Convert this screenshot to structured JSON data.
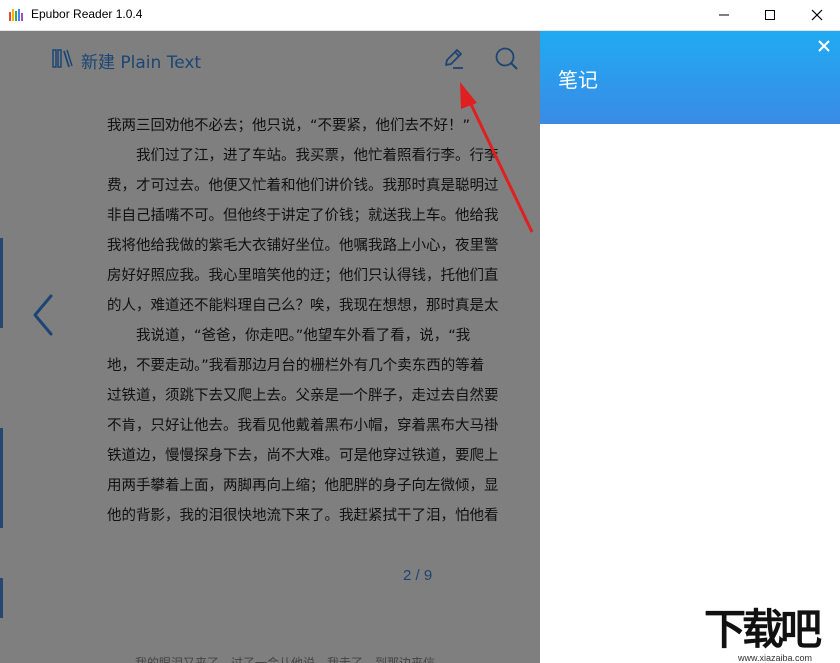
{
  "window": {
    "title": "Epubor Reader 1.0.4",
    "buttons": {
      "minimize": "minimize",
      "maximize": "maximize",
      "close": "close"
    }
  },
  "reader": {
    "book_title": "新建 Plain Text",
    "tools": [
      "pen-icon",
      "search-icon"
    ],
    "paragraph_lines": [
      "我两三回劝他不必去；他只说，“不要紧，他们去不好！”",
      "　　我们过了江，进了车站。我买票，他忙着照看行李。行李",
      "费，才可过去。他便又忙着和他们讲价钱。我那时真是聪明过",
      "非自己插嘴不可。但他终于讲定了价钱；就送我上车。他给我",
      "我将他给我做的紫毛大衣铺好坐位。他嘱我路上小心，夜里警",
      "房好好照应我。我心里暗笑他的迂；他们只认得钱，托他们直",
      "的人，难道还不能料理自己么？唉，我现在想想，那时真是太",
      "　　我说道，“爸爸，你走吧。”他望车外看了看，说，“我",
      "地，不要走动。”我看那边月台的栅栏外有几个卖东西的等着",
      "过铁道，须跳下去又爬上去。父亲是一个胖子，走过去自然要",
      "不肯，只好让他去。我看见他戴着黑布小帽，穿着黑布大马褂",
      "铁道边，慢慢探身下去，尚不大难。可是他穿过铁道，要爬上",
      "用两手攀着上面，两脚再向上缩；他肥胖的身子向左微倾，显",
      "他的背影，我的泪很快地流下来了。我赶紧拭干了泪，怕他看"
    ],
    "page_indicator": "2 / 9",
    "next_page_peek": "我的眼泪又来了。过了一会儿他说，我走了，到那边来信"
  },
  "notes_panel": {
    "title": "笔记",
    "close_label": "×"
  },
  "watermark": {
    "big": "下载吧",
    "small": "www.xiazaiba.com"
  },
  "colors": {
    "accent": "#3a8be6",
    "header_top": "#20aaf2",
    "annotation_arrow": "#e02020"
  }
}
